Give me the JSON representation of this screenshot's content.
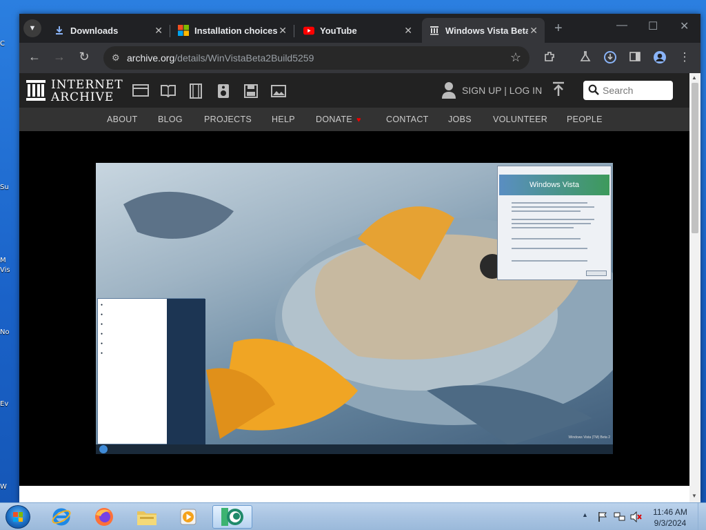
{
  "desktop": {
    "fragments": [
      "C",
      "Su",
      "M",
      "Vis",
      "No",
      "Ev",
      "W"
    ]
  },
  "browser": {
    "tabs": [
      {
        "label": "Downloads",
        "icon": "download-icon",
        "active": false
      },
      {
        "label": "Installation choices",
        "icon": "microsoft-logo-icon",
        "active": false
      },
      {
        "label": "YouTube",
        "icon": "youtube-icon",
        "active": false
      },
      {
        "label": "Windows Vista Beta",
        "icon": "archive-icon",
        "active": true
      }
    ],
    "new_tab": "+",
    "controls": {
      "minimize": "—",
      "maximize": "☐",
      "close": "✕"
    },
    "url": {
      "host": "archive.org",
      "path": "/details/WinVistaBeta2Build5259"
    }
  },
  "ia": {
    "wordmark_line1": "INTERNET",
    "wordmark_line2": "ARCHIVE",
    "signup": "SIGN UP | LOG IN",
    "search_placeholder": "Search",
    "nav": [
      "ABOUT",
      "BLOG",
      "PROJECTS",
      "HELP",
      "DONATE",
      "CONTACT",
      "JOBS",
      "VOLUNTEER",
      "PEOPLE"
    ]
  },
  "vista": {
    "about_title": "Windows Vista",
    "watermark": "Windows Vista (TM) Beta 2"
  },
  "taskbar": {
    "time": "11:46 AM",
    "date": "9/3/2024",
    "apps": [
      "ie-icon",
      "firefox-icon",
      "explorer-folder-icon",
      "media-player-icon",
      "pbs-app-icon"
    ]
  },
  "colors": {
    "chrome_bg": "#202124",
    "chrome_tab_active": "#35363a",
    "ia_header": "#222222",
    "ia_nav": "#333333",
    "donate_heart": "#ee0000"
  }
}
